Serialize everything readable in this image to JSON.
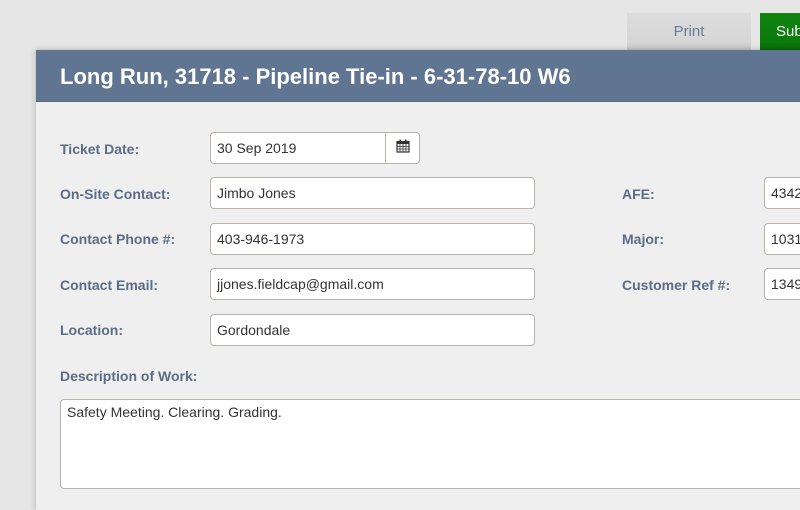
{
  "toolbar": {
    "print_label": "Print",
    "submit_label": "Submit"
  },
  "modal": {
    "title": "Long Run, 31718 - Pipeline Tie-in - 6-31-78-10 W6",
    "fields": {
      "ticket_date": {
        "label": "Ticket Date:",
        "value": "30 Sep 2019"
      },
      "onsite_contact": {
        "label": "On-Site Contact:",
        "value": "Jimbo Jones"
      },
      "contact_phone": {
        "label": "Contact Phone #:",
        "value": "403-946-1973"
      },
      "contact_email": {
        "label": "Contact Email:",
        "value": "jjones.fieldcap@gmail.com"
      },
      "location": {
        "label": "Location:",
        "value": "Gordondale"
      },
      "afe": {
        "label": "AFE:",
        "value": "4342"
      },
      "major": {
        "label": "Major:",
        "value": "1031"
      },
      "customer_ref": {
        "label": "Customer Ref #:",
        "value": "1349"
      },
      "description": {
        "label": "Description of Work:",
        "value": "Safety Meeting. Clearing. Grading."
      }
    }
  },
  "colors": {
    "header_bg": "#5f7591",
    "label_text": "#5a6d86",
    "submit_green": "#0a7a0a"
  }
}
